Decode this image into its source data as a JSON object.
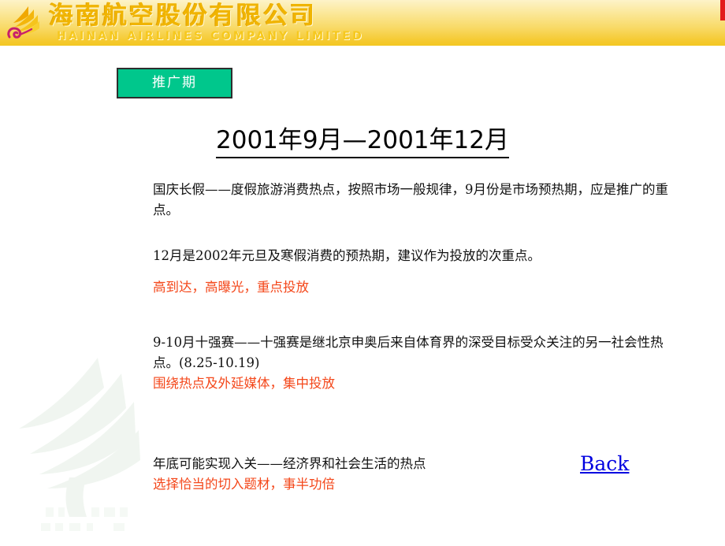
{
  "banner": {
    "company_cn": "海南航空股份有限公司",
    "company_en": "HAINAN AIRLINES COMPANY LIMITED",
    "logo_icon": "hainan-airlines-wing-logo",
    "gradient_top": "#fdf3c8",
    "gradient_bottom": "#f3c722",
    "text_color": "#f0b400",
    "edge_mark_color": "#e21b1b"
  },
  "phase": {
    "label": "推广期",
    "bg_color": "#00c78c",
    "border_color": "#2e2e2e",
    "text_color": "#ffffff"
  },
  "title": "2001年9月—2001年12月",
  "body": {
    "p1": "国庆长假——度假旅游消费热点，按照市场一般规律，9月份是市场预热期，应是推广的重点。",
    "p2": "12月是2002年元旦及寒假消费的预热期，建议作为投放的次重点。",
    "p3_red": "高到达，高曝光，重点投放",
    "p4": "9-10月十强赛——十强赛是继北京申奥后来自体育界的深受目标受众关注的另一社会性热点。(8.25-10.19)",
    "p5_red": "围绕热点及外延媒体，集中投放",
    "p6": "年底可能实现入关——经济界和社会生活的热点",
    "p7_red": "选择恰当的切入题材，事半功倍"
  },
  "colors": {
    "red_emphasis": "#f4471a",
    "link_blue": "#0000e0",
    "body_text": "#111111"
  },
  "back_link": {
    "label": "Back",
    "icon": "back-link"
  },
  "watermark": {
    "icon": "wing-watermark",
    "color": "#cfe0cf"
  }
}
